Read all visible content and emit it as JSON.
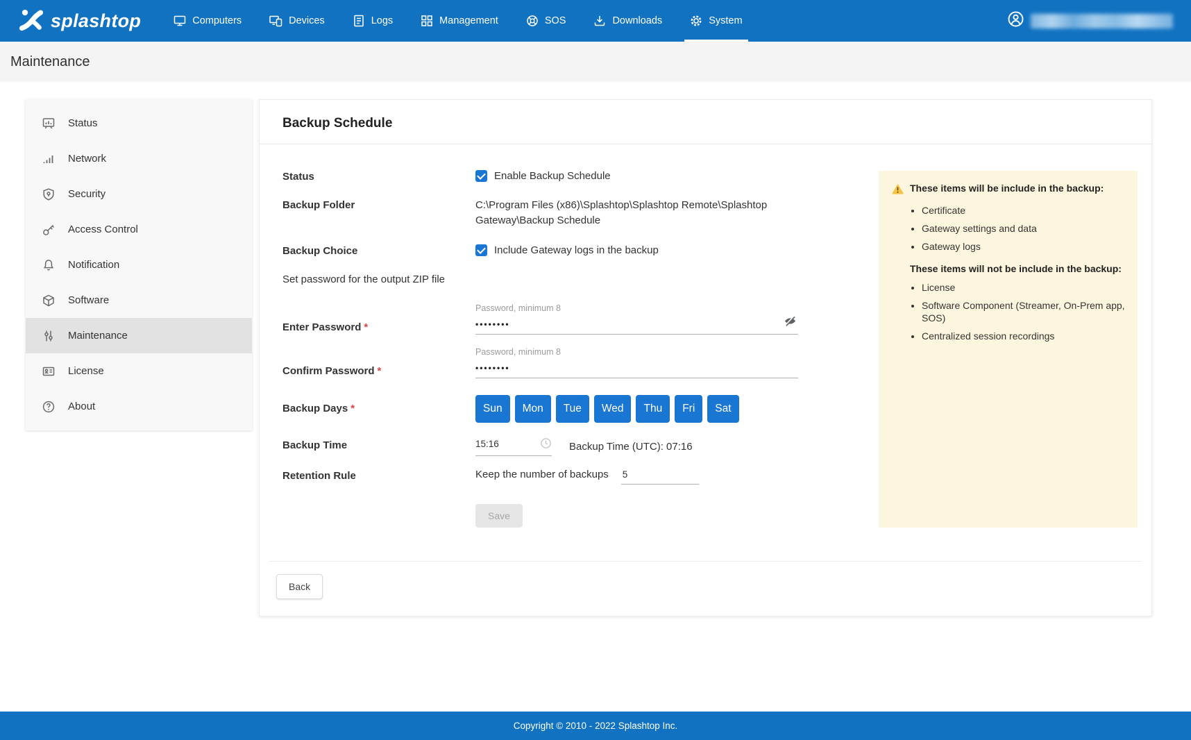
{
  "nav": {
    "brand": "splashtop",
    "items": [
      {
        "label": "Computers",
        "icon": "computers-icon"
      },
      {
        "label": "Devices",
        "icon": "devices-icon"
      },
      {
        "label": "Logs",
        "icon": "logs-icon"
      },
      {
        "label": "Management",
        "icon": "management-icon"
      },
      {
        "label": "SOS",
        "icon": "sos-icon"
      },
      {
        "label": "Downloads",
        "icon": "downloads-icon"
      },
      {
        "label": "System",
        "icon": "system-icon",
        "active": true
      }
    ]
  },
  "page": {
    "title": "Maintenance"
  },
  "sidebar": {
    "items": [
      {
        "label": "Status",
        "icon": "status-icon"
      },
      {
        "label": "Network",
        "icon": "network-icon"
      },
      {
        "label": "Security",
        "icon": "security-icon"
      },
      {
        "label": "Access Control",
        "icon": "access-control-icon"
      },
      {
        "label": "Notification",
        "icon": "notification-icon"
      },
      {
        "label": "Software",
        "icon": "software-icon"
      },
      {
        "label": "Maintenance",
        "icon": "maintenance-icon",
        "selected": true
      },
      {
        "label": "License",
        "icon": "license-icon"
      },
      {
        "label": "About",
        "icon": "about-icon"
      }
    ]
  },
  "form": {
    "title": "Backup Schedule",
    "status_label": "Status",
    "enable_label": "Enable Backup Schedule",
    "backup_folder_label": "Backup Folder",
    "backup_folder_value": "C:\\Program Files (x86)\\Splashtop\\Splashtop Remote\\Splashtop Gateway\\Backup Schedule",
    "backup_choice_label": "Backup Choice",
    "include_logs_label": "Include Gateway logs in the backup",
    "zip_note": "Set password for the output ZIP file",
    "enter_password_label": "Enter Password",
    "confirm_password_label": "Confirm Password",
    "required_marker": "*",
    "password_hint": "Password, minimum 8",
    "password_value": "••••••••",
    "confirm_password_value": "••••••••",
    "backup_days_label": "Backup Days",
    "days": [
      "Sun",
      "Mon",
      "Tue",
      "Wed",
      "Thu",
      "Fri",
      "Sat"
    ],
    "backup_time_label": "Backup Time",
    "backup_time_value": "15:16",
    "backup_time_utc": "Backup Time (UTC): 07:16",
    "retention_label": "Retention Rule",
    "retention_text": "Keep the number of backups",
    "retention_value": "5",
    "save_label": "Save",
    "back_label": "Back"
  },
  "info_box": {
    "include_title": "These items will be include in the backup:",
    "include_items": [
      "Certificate",
      "Gateway settings and data",
      "Gateway logs"
    ],
    "exclude_title": "These items will not be include in the backup:",
    "exclude_items": [
      "License",
      "Software Component (Streamer, On-Prem app, SOS)",
      "Centralized session recordings"
    ]
  },
  "footer": {
    "copyright": "Copyright © 2010 - 2022 Splashtop Inc."
  },
  "colors": {
    "brand_blue": "#1172c1",
    "control_blue": "#1976d2",
    "warning_bg": "#fdf6de",
    "selected_gray": "#e2e2e2"
  }
}
